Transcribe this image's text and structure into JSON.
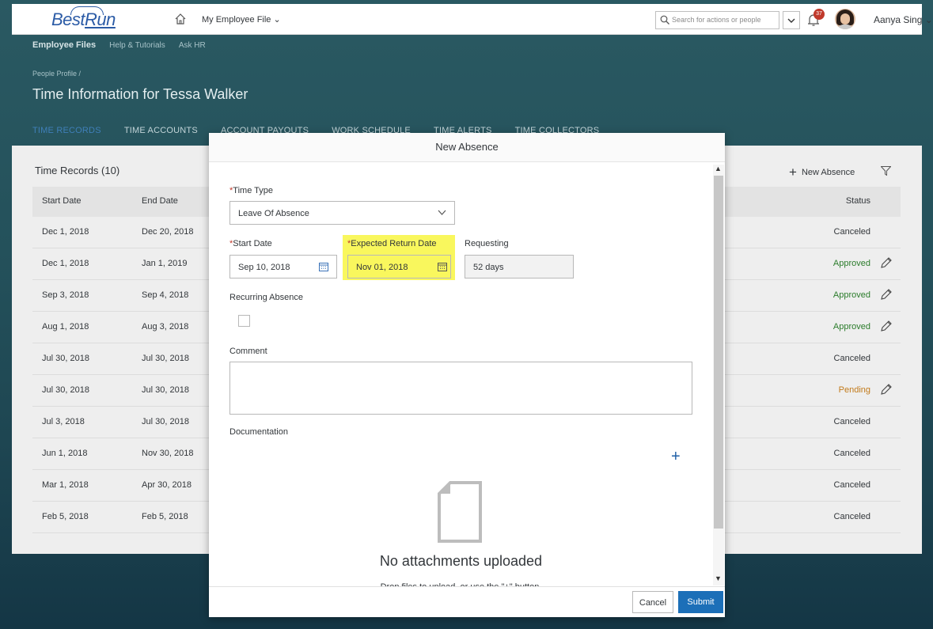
{
  "shell": {
    "logo_best": "Best",
    "logo_run": "Run",
    "menu_title": "My Employee File ⌄",
    "search_placeholder": "Search for actions or people",
    "notification_count": "37",
    "user_name": "Aanya Sing ⌄"
  },
  "subnav": [
    "Employee Files",
    "Help & Tutorials",
    "Ask HR"
  ],
  "breadcrumb": "People Profile /",
  "page_title": "Time Information for Tessa Walker",
  "tabs": [
    "TIME RECORDS",
    "TIME ACCOUNTS",
    "ACCOUNT PAYOUTS",
    "WORK SCHEDULE",
    "TIME ALERTS",
    "TIME COLLECTORS"
  ],
  "table": {
    "title": "Time Records (10)",
    "new_absence": "New Absence",
    "columns": {
      "start": "Start Date",
      "end": "End Date",
      "status": "Status"
    },
    "rows": [
      {
        "start": "Dec 1, 2018",
        "end": "Dec 20, 2018",
        "status": "Canceled",
        "editable": false
      },
      {
        "start": "Dec 1, 2018",
        "end": "Jan 1, 2019",
        "status": "Approved",
        "editable": true
      },
      {
        "start": "Sep 3, 2018",
        "end": "Sep 4, 2018",
        "status": "Approved",
        "editable": true
      },
      {
        "start": "Aug 1, 2018",
        "end": "Aug 3, 2018",
        "status": "Approved",
        "editable": true
      },
      {
        "start": "Jul 30, 2018",
        "end": "Jul 30, 2018",
        "status": "Canceled",
        "editable": false
      },
      {
        "start": "Jul 30, 2018",
        "end": "Jul 30, 2018",
        "status": "Pending",
        "editable": true
      },
      {
        "start": "Jul 3, 2018",
        "end": "Jul 30, 2018",
        "status": "Canceled",
        "editable": false
      },
      {
        "start": "Jun 1, 2018",
        "end": "Nov 30, 2018",
        "status": "Canceled",
        "editable": false
      },
      {
        "start": "Mar 1, 2018",
        "end": "Apr 30, 2018",
        "status": "Canceled",
        "editable": false
      },
      {
        "start": "Feb 5, 2018",
        "end": "Feb 5, 2018",
        "status": "Canceled",
        "editable": false
      }
    ]
  },
  "status_colors": {
    "Canceled": "#32363a",
    "Approved": "#2b7c2b",
    "Pending": "#c27a1a"
  },
  "dialog": {
    "title": "New Absence",
    "time_type_label": "Time Type",
    "time_type_value": "Leave Of Absence",
    "start_date_label": "Start Date",
    "start_date_value": "Sep 10, 2018",
    "return_date_label": "Expected Return Date",
    "return_date_value": "Nov 01, 2018",
    "requesting_label": "Requesting",
    "requesting_value": "52 days",
    "recurring_label": "Recurring Absence",
    "comment_label": "Comment",
    "documentation_label": "Documentation",
    "no_attachments": "No attachments uploaded",
    "drop_hint": "Drop files to upload, or use the \"+\" button.",
    "cancel": "Cancel",
    "submit": "Submit"
  },
  "colors": {
    "accent": "#1c6fb8",
    "highlight": "#f9f75d",
    "required": "#c0392b"
  }
}
